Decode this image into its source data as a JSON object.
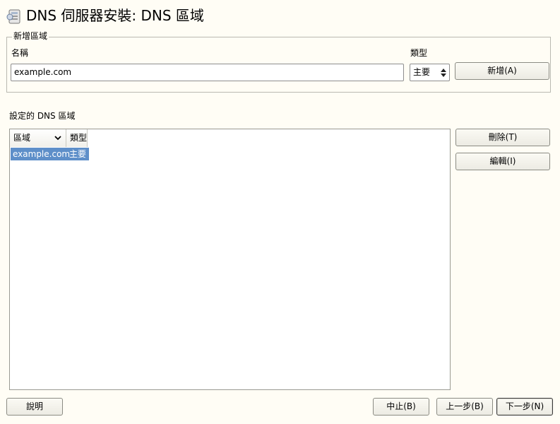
{
  "window": {
    "title": "DNS 伺服器安裝: DNS 區域"
  },
  "add_zone": {
    "group_label": "新增區域",
    "name_label": "名稱",
    "name_value": "example.com",
    "type_label": "類型",
    "type_value": "主要",
    "add_button": "新增(A)"
  },
  "zones": {
    "section_label": "設定的 DNS 區域",
    "columns": [
      "區域",
      "類型"
    ],
    "rows": [
      {
        "zone": "example.com",
        "type": "主要"
      }
    ],
    "delete_button": "刪除(T)",
    "edit_button": "編輯(I)"
  },
  "footer": {
    "help_button": "說明",
    "abort_button": "中止(B)",
    "back_button": "上一步(B)",
    "next_button": "下一步(N)"
  }
}
